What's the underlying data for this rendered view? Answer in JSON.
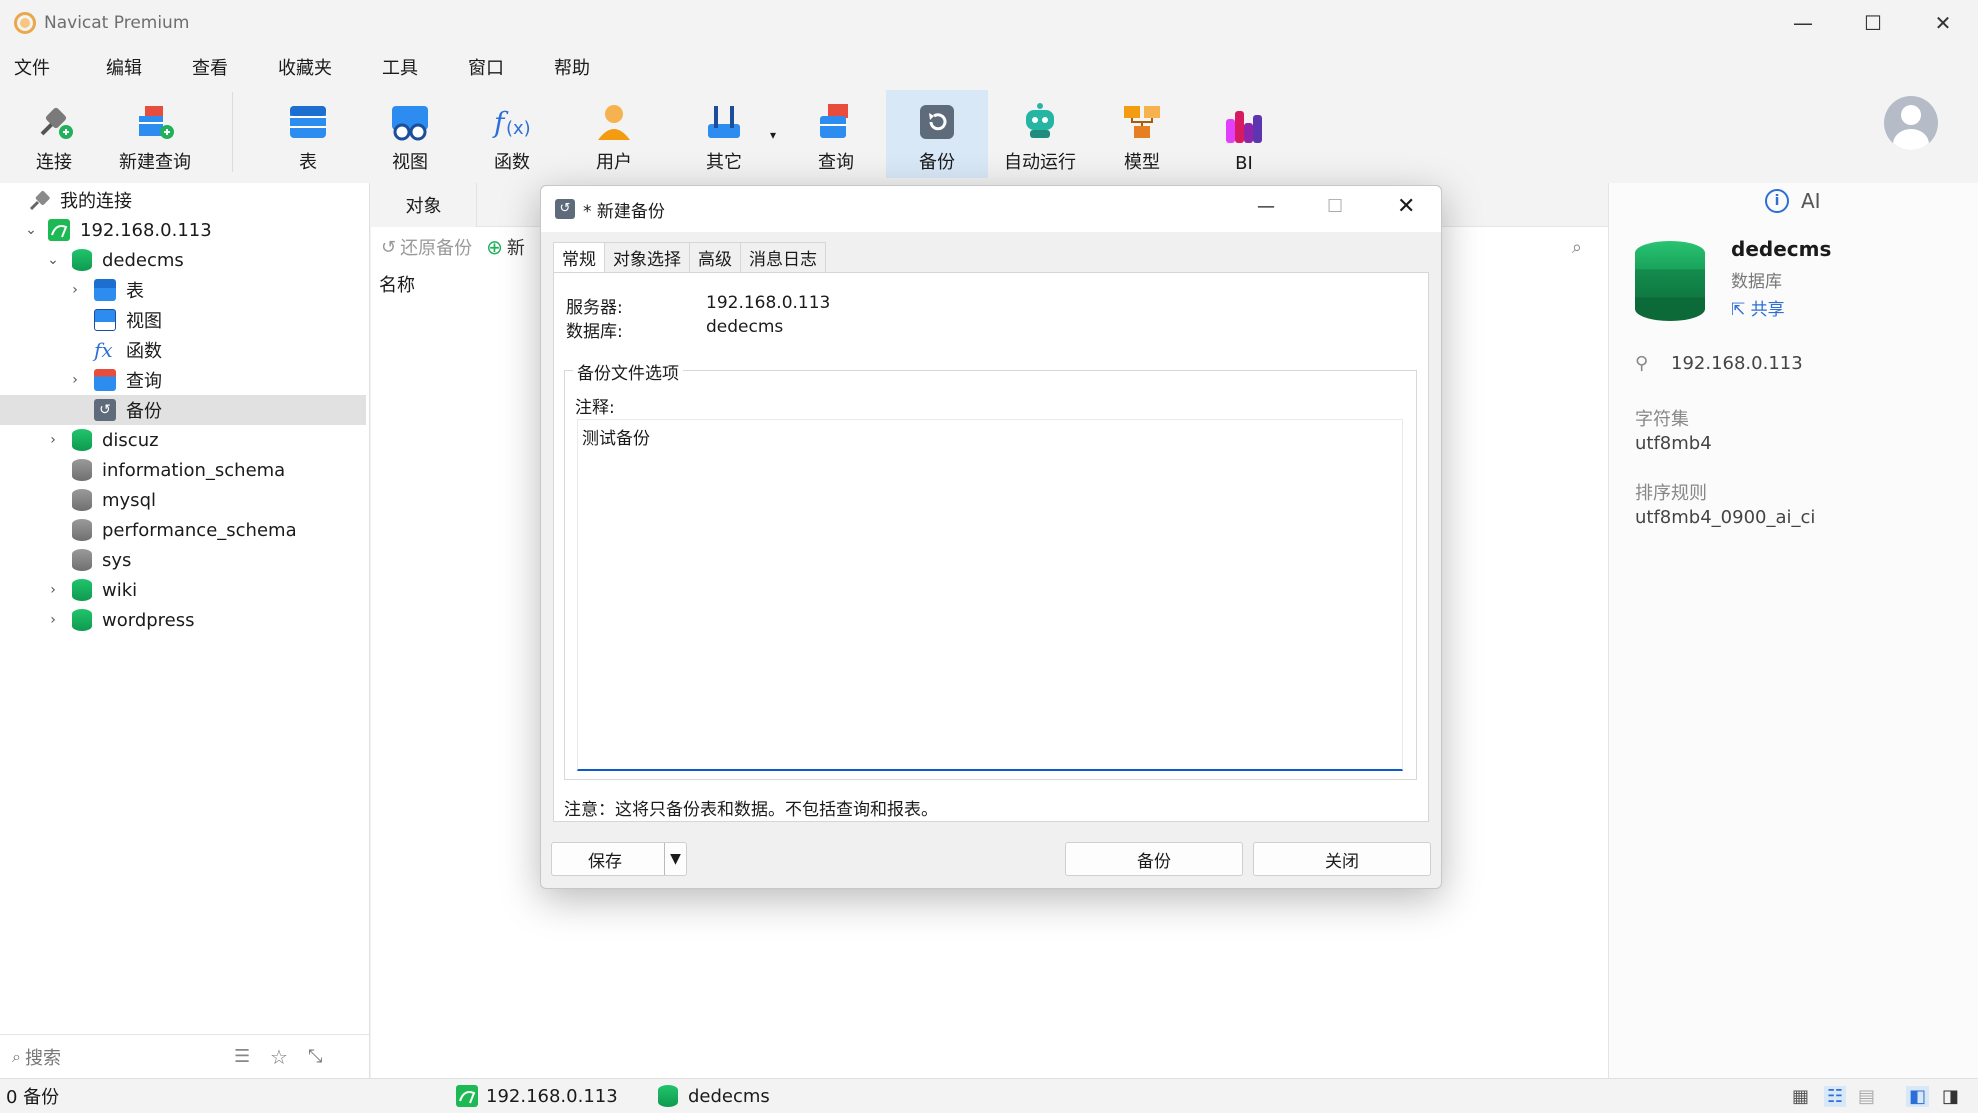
{
  "app": {
    "title": "Navicat Premium"
  },
  "menu": [
    "文件",
    "编辑",
    "查看",
    "收藏夹",
    "工具",
    "窗口",
    "帮助"
  ],
  "toolbar": {
    "connect": "连接",
    "new_query": "新建查询",
    "table": "表",
    "view": "视图",
    "function": "函数",
    "user": "用户",
    "other": "其它",
    "query": "查询",
    "backup": "备份",
    "automation": "自动运行",
    "model": "模型",
    "bi": "BI"
  },
  "tree": {
    "root": "我的连接",
    "connection": "192.168.0.113",
    "db_selected": "dedecms",
    "children": {
      "table": "表",
      "view": "视图",
      "function": "函数",
      "query": "查询",
      "backup": "备份"
    },
    "databases": [
      "discuz",
      "information_schema",
      "mysql",
      "performance_schema",
      "sys",
      "wiki",
      "wordpress"
    ]
  },
  "left_search": {
    "placeholder": "搜索"
  },
  "center": {
    "tab": "对象",
    "restore_backup": "还原备份",
    "new_backup_partial": "新",
    "col_name": "名称"
  },
  "dialog": {
    "title": "* 新建备份",
    "tabs": [
      "常规",
      "对象选择",
      "高级",
      "消息日志"
    ],
    "server_label": "服务器:",
    "server_value": "192.168.0.113",
    "database_label": "数据库:",
    "database_value": "dedecms",
    "group_title": "备份文件选项",
    "comment_label": "注释:",
    "comment_value": "测试备份",
    "note": "注意：这将只备份表和数据。不包括查询和报表。",
    "save_button": "保存",
    "backup_button": "备份",
    "close_button": "关闭"
  },
  "right_panel": {
    "ai_label": "AI",
    "db_name": "dedecms",
    "db_type": "数据库",
    "share": "共享",
    "host": "192.168.0.113",
    "charset_label": "字符集",
    "charset_value": "utf8mb4",
    "collation_label": "排序规则",
    "collation_value": "utf8mb4_0900_ai_ci"
  },
  "status": {
    "count": "0 备份",
    "connection": "192.168.0.113",
    "database": "dedecms"
  },
  "colors": {
    "accent": "#0b5cc8",
    "db_green": "#12a85a",
    "selected_tool": "#d9e8f7"
  }
}
